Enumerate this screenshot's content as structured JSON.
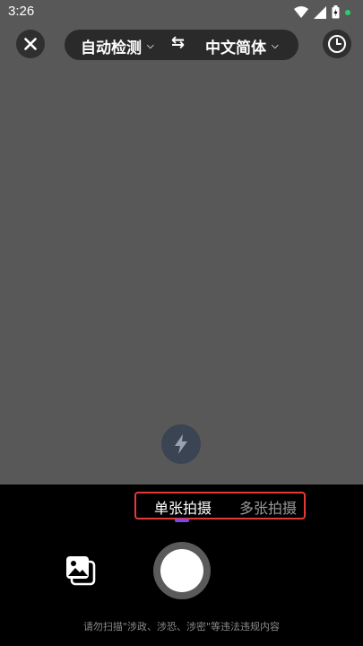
{
  "status": {
    "time": "3:26"
  },
  "toolbar": {
    "source_lang": "自动检测",
    "swap_symbol": "⇆",
    "target_lang": "中文简体"
  },
  "modes": {
    "single": "单张拍摄",
    "multi": "多张拍摄",
    "selected": "single"
  },
  "notice": "请勿扫描\"涉政、涉恐、涉密\"等违法违规内容",
  "icons": [
    "close-icon",
    "history-clock-icon",
    "flash-icon",
    "gallery-icon",
    "wifi-icon",
    "cellular-icon",
    "battery-icon"
  ],
  "colors": {
    "camera_bg": "#585858",
    "mode_highlight": "#e53935",
    "indicator": "#7b48e8",
    "status_dot": "#2ecc71"
  }
}
